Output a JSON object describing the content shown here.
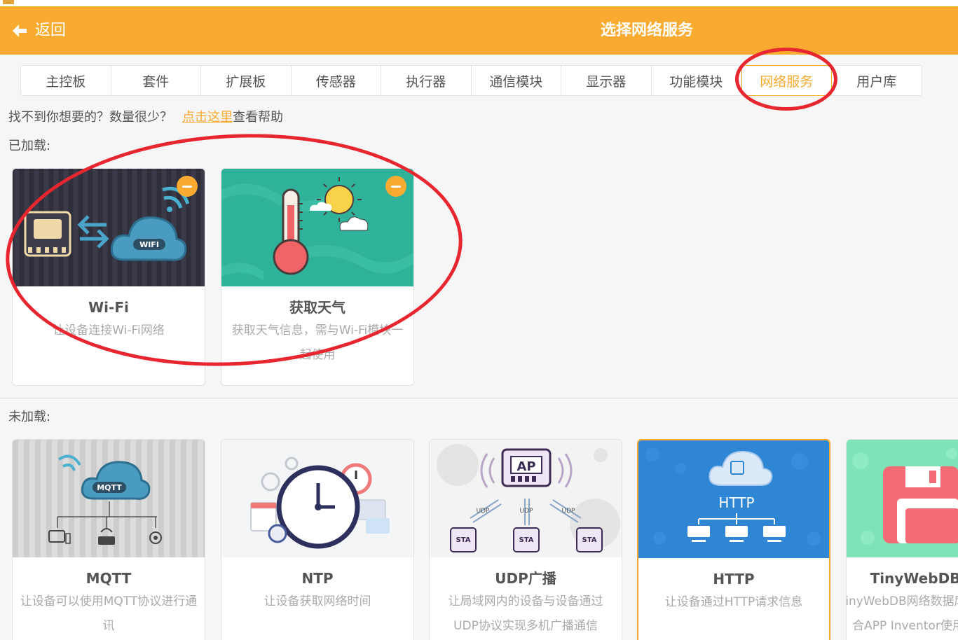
{
  "header": {
    "back_label": "返回",
    "title": "选择网络服务"
  },
  "tabs": [
    {
      "label": "主控板"
    },
    {
      "label": "套件"
    },
    {
      "label": "扩展板"
    },
    {
      "label": "传感器"
    },
    {
      "label": "执行器"
    },
    {
      "label": "通信模块"
    },
    {
      "label": "显示器"
    },
    {
      "label": "功能模块"
    },
    {
      "label": "网络服务"
    },
    {
      "label": "用户库"
    }
  ],
  "active_tab": "网络服务",
  "help": {
    "prefix": "找不到你想要的？数量很少？",
    "link": "点击这里",
    "suffix": "查看帮助"
  },
  "loaded": {
    "label": "已加载:",
    "items": [
      {
        "name": "Wi-Fi",
        "desc": "让设备连接Wi-Fi网络",
        "thumb_text": "WIFI"
      },
      {
        "name": "获取天气",
        "desc": "获取天气信息，需与Wi-Fi模块一起使用"
      }
    ]
  },
  "unloaded": {
    "label": "未加载:",
    "items": [
      {
        "name": "MQTT",
        "desc": "让设备可以使用MQTT协议进行通讯",
        "thumb_text": "MQTT"
      },
      {
        "name": "NTP",
        "desc": "让设备获取网络时间"
      },
      {
        "name": "UDP广播",
        "desc": "让局域网内的设备与设备通过UDP协议实现多机广播通信",
        "thumb_text": {
          "ap": "AP",
          "udp": "UDP",
          "sta": "STA"
        }
      },
      {
        "name": "HTTP",
        "desc": "让设备通过HTTP请求信息",
        "thumb_text": "HTTP"
      },
      {
        "name": "TinyWebDB",
        "desc": "操作TinyWebDB网络数据库，可配合APP Inventor使用"
      }
    ]
  },
  "colors": {
    "accent": "#f8ab30",
    "annotation": "#e8262f"
  }
}
